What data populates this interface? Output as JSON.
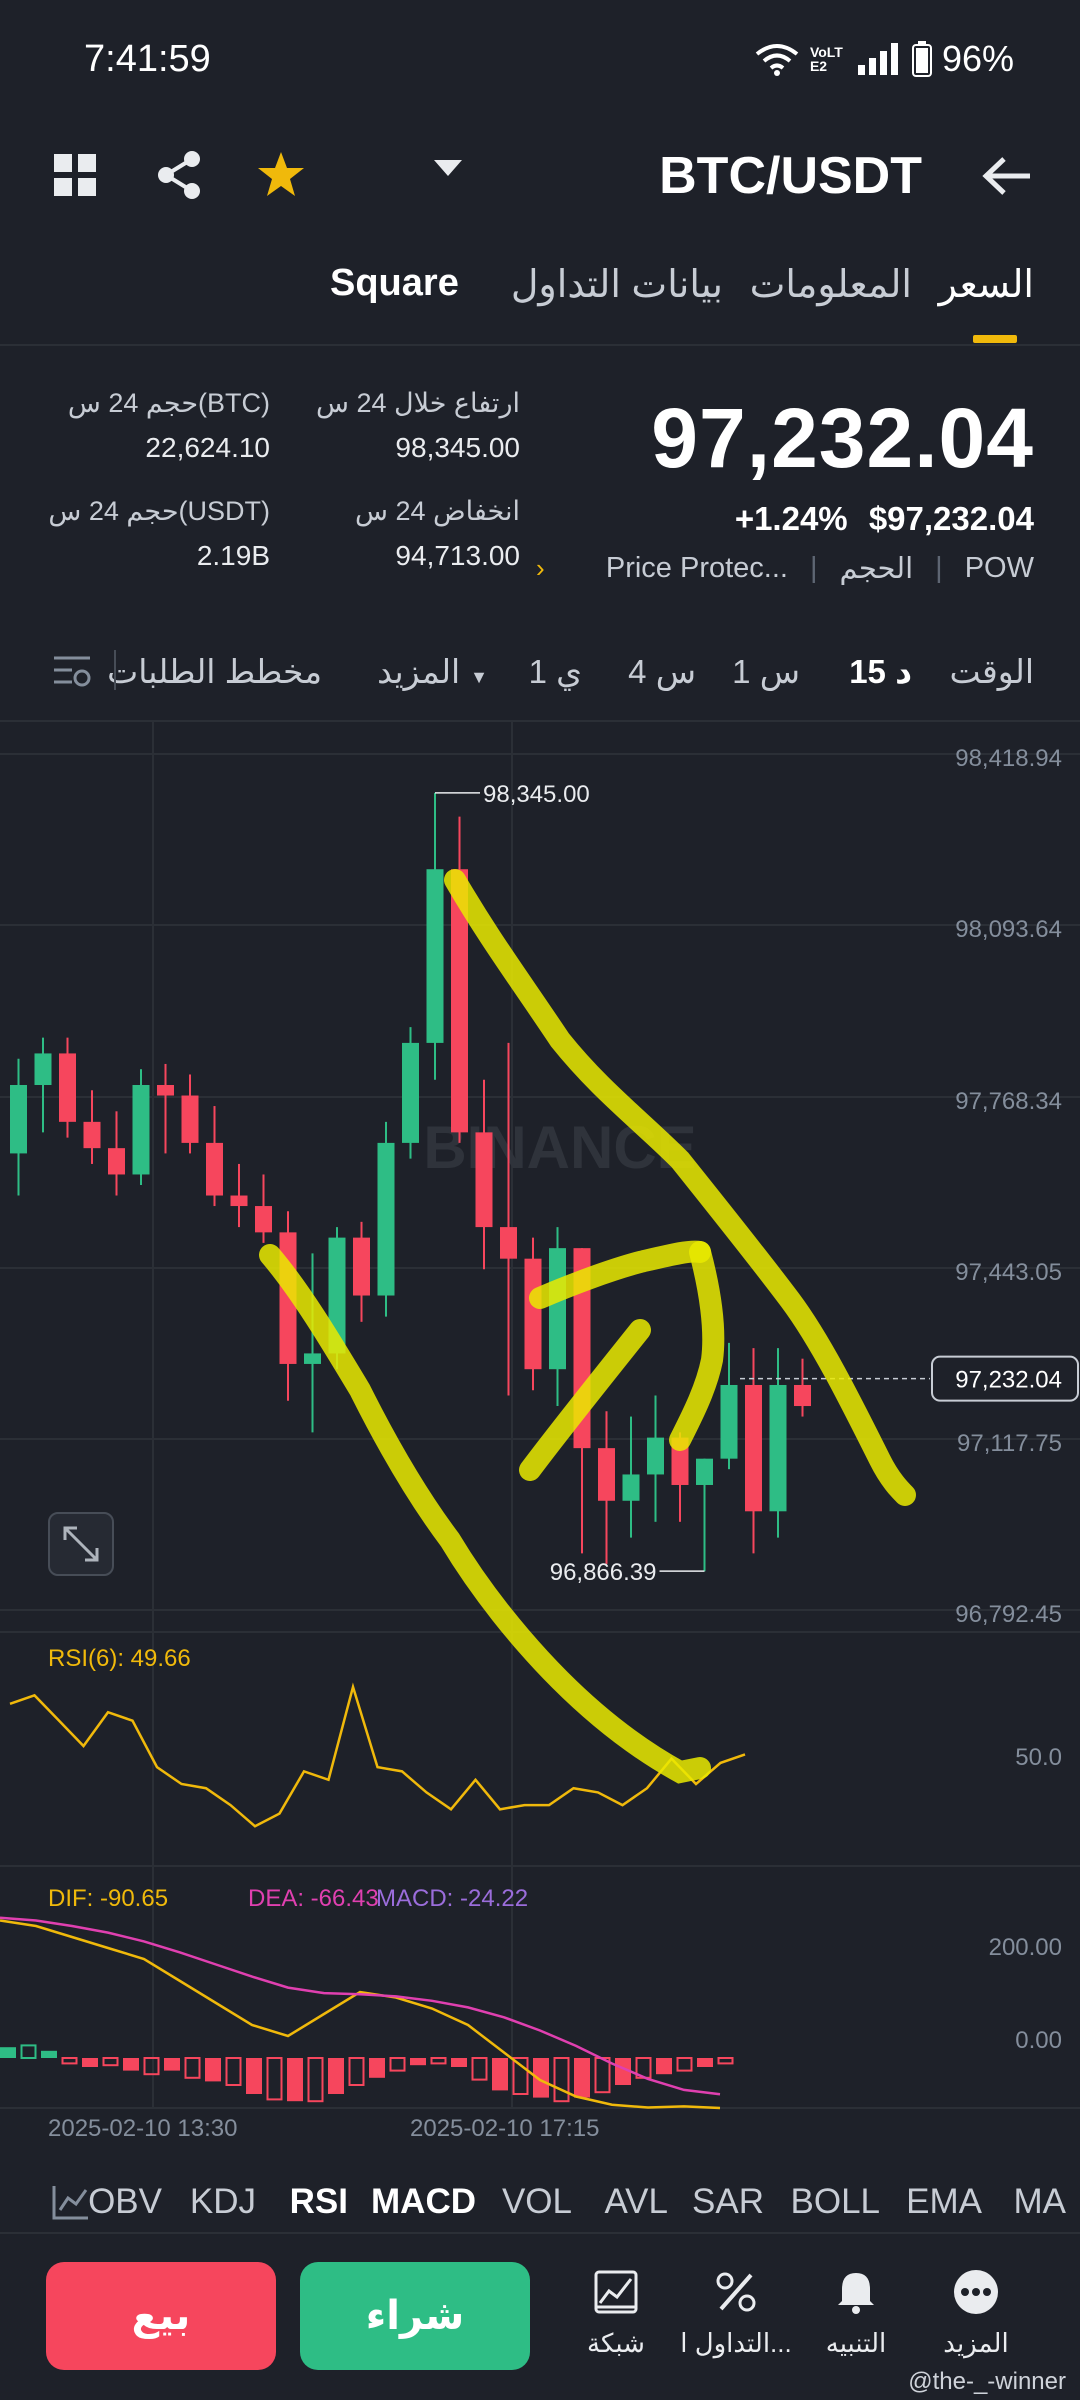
{
  "status_bar": {
    "time": "7:41:59",
    "battery": "96%",
    "network": "VoLTE2"
  },
  "header": {
    "pair": "BTC/USDT",
    "icons": [
      "grid-icon",
      "share-icon",
      "star-icon",
      "back-arrow-icon"
    ]
  },
  "tabs": [
    {
      "label": "السعر",
      "active": true
    },
    {
      "label": "المعلومات",
      "active": false
    },
    {
      "label": "بيانات التداول",
      "active": false
    },
    {
      "label": "Square",
      "active": false
    }
  ],
  "ticker": {
    "last_price": "97,232.04",
    "change": "+1.24%",
    "price_usd": "$97,232.04",
    "tags": [
      "POW",
      "الحجم",
      "Price Protec..."
    ],
    "high_24h_label": "ارتفاع خلال 24 س",
    "high_24h": "98,345.00",
    "low_24h_label": "انخفاض 24 س",
    "low_24h": "94,713.00",
    "vol_btc_label": "حجم 24 س(BTC)",
    "vol_btc": "22,624.10",
    "vol_usdt_label": "حجم 24 س(USDT)",
    "vol_usdt": "2.19B"
  },
  "intervals": {
    "time_label": "الوقت",
    "items": [
      "15 د",
      "1 س",
      "4 س",
      "1 ي"
    ],
    "active": "15 د",
    "more": "المزيد",
    "depth": "مخطط الطلبات"
  },
  "chart_data": {
    "type": "candlestick",
    "price_axis": [
      "98,418.94",
      "98,093.64",
      "97,768.34",
      "97,443.05",
      "97,117.75",
      "96,792.45"
    ],
    "current_price_tag": "97,232.04",
    "high_marker": "98,345.00",
    "low_marker": "96,866.39",
    "watermark": "BINANCE",
    "x_labels": [
      "2025-02-10 13:30",
      "2025-02-10 17:15"
    ],
    "candles": [
      {
        "o": 97660,
        "h": 97840,
        "l": 97580,
        "c": 97790
      },
      {
        "o": 97790,
        "h": 97880,
        "l": 97700,
        "c": 97850
      },
      {
        "o": 97850,
        "h": 97880,
        "l": 97690,
        "c": 97720
      },
      {
        "o": 97720,
        "h": 97780,
        "l": 97640,
        "c": 97670
      },
      {
        "o": 97670,
        "h": 97740,
        "l": 97580,
        "c": 97620
      },
      {
        "o": 97620,
        "h": 97820,
        "l": 97600,
        "c": 97790
      },
      {
        "o": 97790,
        "h": 97830,
        "l": 97660,
        "c": 97770
      },
      {
        "o": 97770,
        "h": 97810,
        "l": 97660,
        "c": 97680
      },
      {
        "o": 97680,
        "h": 97750,
        "l": 97560,
        "c": 97580
      },
      {
        "o": 97580,
        "h": 97640,
        "l": 97520,
        "c": 97560
      },
      {
        "o": 97560,
        "h": 97620,
        "l": 97490,
        "c": 97510
      },
      {
        "o": 97510,
        "h": 97550,
        "l": 97190,
        "c": 97260
      },
      {
        "o": 97260,
        "h": 97470,
        "l": 97130,
        "c": 97280
      },
      {
        "o": 97280,
        "h": 97520,
        "l": 97250,
        "c": 97500
      },
      {
        "o": 97500,
        "h": 97530,
        "l": 97340,
        "c": 97390
      },
      {
        "o": 97390,
        "h": 97720,
        "l": 97350,
        "c": 97680
      },
      {
        "o": 97680,
        "h": 97900,
        "l": 97650,
        "c": 97870
      },
      {
        "o": 97870,
        "h": 98345,
        "l": 97800,
        "c": 98200
      },
      {
        "o": 98200,
        "h": 98300,
        "l": 97680,
        "c": 97700
      },
      {
        "o": 97700,
        "h": 97800,
        "l": 97440,
        "c": 97520
      },
      {
        "o": 97520,
        "h": 97870,
        "l": 97200,
        "c": 97460
      },
      {
        "o": 97460,
        "h": 97500,
        "l": 97210,
        "c": 97250
      },
      {
        "o": 97250,
        "h": 97520,
        "l": 97180,
        "c": 97480
      },
      {
        "o": 97480,
        "h": 97480,
        "l": 96900,
        "c": 97100
      },
      {
        "o": 97100,
        "h": 97170,
        "l": 96880,
        "c": 97000
      },
      {
        "o": 97000,
        "h": 97160,
        "l": 96930,
        "c": 97050
      },
      {
        "o": 97050,
        "h": 97200,
        "l": 96960,
        "c": 97120
      },
      {
        "o": 97120,
        "h": 97130,
        "l": 96960,
        "c": 97030
      },
      {
        "o": 97030,
        "h": 97080,
        "l": 96866,
        "c": 97080
      },
      {
        "o": 97080,
        "h": 97300,
        "l": 97060,
        "c": 97220
      },
      {
        "o": 97220,
        "h": 97290,
        "l": 96900,
        "c": 96980
      },
      {
        "o": 96980,
        "h": 97290,
        "l": 96930,
        "c": 97220
      },
      {
        "o": 97220,
        "h": 97270,
        "l": 97160,
        "c": 97180
      }
    ],
    "rsi": {
      "label": "RSI(6): 49.66",
      "level": "50.0",
      "values": [
        62,
        64,
        58,
        52,
        60,
        58,
        47,
        43,
        42,
        38,
        33,
        36,
        46,
        44,
        66,
        47,
        46,
        41,
        37,
        44,
        37,
        38,
        38,
        42,
        41,
        38,
        42,
        49,
        43,
        48,
        50
      ]
    },
    "macd": {
      "dif_label": "DIF: -90.65",
      "dea_label": "DEA: -66.43",
      "macd_label": "MACD: -24.22",
      "levels": [
        "200.00",
        "0.00"
      ],
      "hist": [
        12,
        14,
        8,
        -6,
        -10,
        -8,
        -14,
        -18,
        -14,
        -22,
        -26,
        -30,
        -40,
        -46,
        -48,
        -48,
        -40,
        -30,
        -22,
        -14,
        -8,
        -6,
        -10,
        -24,
        -36,
        -40,
        -44,
        -48,
        -44,
        -38,
        -30,
        -22,
        -18,
        -14,
        -10,
        -6
      ],
      "dif": [
        250,
        240,
        220,
        200,
        180,
        140,
        100,
        60,
        40,
        80,
        120,
        110,
        90,
        60,
        10,
        -40,
        -70,
        -85,
        -90,
        -88,
        -91
      ],
      "dea": [
        255,
        250,
        240,
        228,
        212,
        192,
        170,
        148,
        128,
        118,
        116,
        112,
        104,
        92,
        74,
        50,
        22,
        -10,
        -38,
        -58,
        -66
      ]
    }
  },
  "indicators": {
    "items": [
      "MA",
      "EMA",
      "BOLL",
      "SAR",
      "AVL",
      "VOL",
      "MACD",
      "RSI",
      "KDJ",
      "OBV"
    ],
    "active": [
      "MACD",
      "RSI"
    ]
  },
  "actions": {
    "sell": "بيع",
    "buy": "شراء",
    "nav": [
      {
        "label": "شبكة",
        "icon": "grid-bot-icon"
      },
      {
        "label": "التداول ا...",
        "icon": "percent-icon"
      },
      {
        "label": "التنبيه",
        "icon": "bell-icon"
      },
      {
        "label": "المزيد",
        "icon": "more-icon"
      }
    ]
  },
  "attribution": "@the-_-winner",
  "colors": {
    "up": "#2ebd85",
    "down": "#f6465d",
    "accent": "#f0b90b",
    "bg": "#1e2129",
    "annotation": "#eaea00"
  }
}
